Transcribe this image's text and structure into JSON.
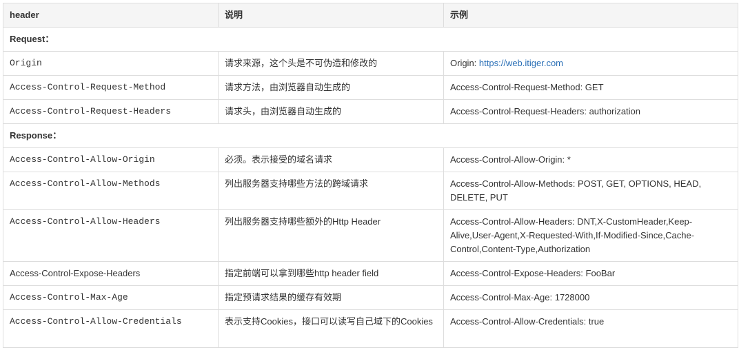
{
  "table": {
    "headers": [
      "header",
      "说明",
      "示例"
    ],
    "sections": {
      "request": "Request：",
      "response": "Response："
    },
    "rows": [
      {
        "header": "Origin",
        "desc": "请求来源，这个头是不可伪造和修改的",
        "example_prefix": "Origin: ",
        "example_link": "https://web.itiger.com"
      },
      {
        "header": "Access-Control-Request-Method",
        "desc": "请求方法，由浏览器自动生成的",
        "example": "Access-Control-Request-Method: GET"
      },
      {
        "header": "Access-Control-Request-Headers",
        "desc": "请求头，由浏览器自动生成的",
        "example": "Access-Control-Request-Headers: authorization"
      },
      {
        "header": "Access-Control-Allow-Origin",
        "desc": "必须。表示接受的域名请求",
        "example": "Access-Control-Allow-Origin: *"
      },
      {
        "header": "Access-Control-Allow-Methods",
        "desc": "列出服务器支持哪些方法的跨域请求",
        "example": "Access-Control-Allow-Methods: POST, GET, OPTIONS, HEAD, DELETE, PUT"
      },
      {
        "header": "Access-Control-Allow-Headers",
        "desc": "列出服务器支持哪些额外的Http Header",
        "example": "Access-Control-Allow-Headers: DNT,X-CustomHeader,Keep-Alive,User-Agent,X-Requested-With,If-Modified-Since,Cache-Control,Content-Type,Authorization"
      },
      {
        "header": "Access-Control-Expose-Headers",
        "desc": "指定前端可以拿到哪些http header field",
        "example": "Access-Control-Expose-Headers: FooBar"
      },
      {
        "header": "Access-Control-Max-Age",
        "desc": "指定预请求结果的缓存有效期",
        "example": "Access-Control-Max-Age: 1728000"
      },
      {
        "header": "Access-Control-Allow-Credentials",
        "desc": "表示支持Cookies，接口可以读写自己域下的Cookies",
        "example": "Access-Control-Allow-Credentials: true"
      }
    ]
  }
}
